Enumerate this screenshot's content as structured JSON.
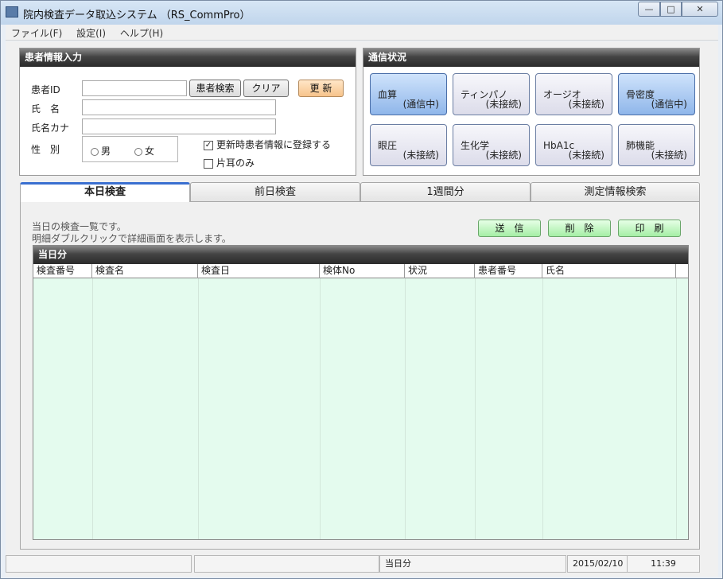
{
  "window": {
    "title": "院内検査データ取込システム （RS_CommPro）",
    "min": "—",
    "max": "□",
    "close": "✕"
  },
  "menu": [
    "ファイル(F)",
    "設定(I)",
    "ヘルプ(H)"
  ],
  "patient_panel": {
    "title": "患者情報入力",
    "id_label": "患者ID",
    "search_btn": "患者検索",
    "clear_btn": "クリア",
    "update_btn": "更 新",
    "name_label": "氏　名",
    "kana_label": "氏名カナ",
    "sex_label": "性　別",
    "male": "男",
    "female": "女",
    "register_check": {
      "label": "更新時患者情報に登録する",
      "checked": true
    },
    "one_ear_check": {
      "label": "片耳のみ",
      "checked": false
    },
    "id_value": "",
    "name_value": "",
    "kana_value": ""
  },
  "comm_panel": {
    "title": "通信状況",
    "devices": [
      {
        "name": "血算",
        "status": "(通信中)",
        "active": true
      },
      {
        "name": "ティンパノ",
        "status": "(未接続)",
        "active": false
      },
      {
        "name": "オージオ",
        "status": "(未接続)",
        "active": false
      },
      {
        "name": "骨密度",
        "status": "(通信中)",
        "active": true
      },
      {
        "name": "眼圧",
        "status": "(未接続)",
        "active": false
      },
      {
        "name": "生化学",
        "status": "(未接続)",
        "active": false
      },
      {
        "name": "HbA1c",
        "status": "(未接続)",
        "active": false
      },
      {
        "name": "肺機能",
        "status": "(未接続)",
        "active": false
      }
    ]
  },
  "tabs": [
    "本日検査",
    "前日検査",
    "1週間分",
    "測定情報検索"
  ],
  "today": {
    "desc1": "当日の検査一覧です。",
    "desc2": "明細ダブルクリックで詳細画面を表示します。",
    "send_btn": "送　信",
    "delete_btn": "削　除",
    "print_btn": "印　刷",
    "grid_title": "当日分",
    "columns": [
      "検査番号",
      "検査名",
      "検査日",
      "検体No",
      "状況",
      "患者番号",
      "氏名"
    ],
    "rows": []
  },
  "status": {
    "center": "当日分",
    "date": "2015/02/10",
    "time": "11:39"
  },
  "colors": {
    "grid_bg": "#e4fbee",
    "active_device": "#8fb6ea",
    "tab_accent": "#3a6fd0"
  }
}
